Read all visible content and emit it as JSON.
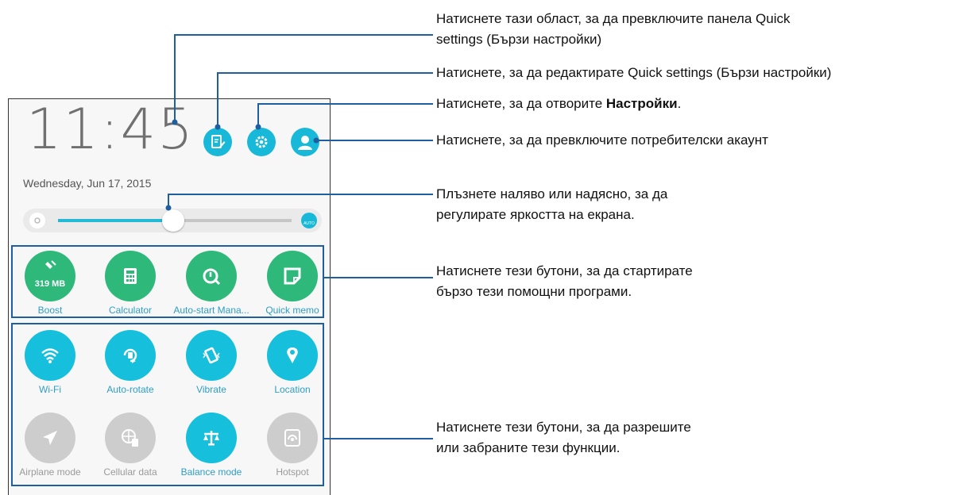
{
  "panel": {
    "clock": "11:45",
    "date": "Wednesday, Jun 17, 2015",
    "brightness_level_percent": 45,
    "brightness_auto_label": "AUTO"
  },
  "utilities": [
    {
      "label": "Boost",
      "badge": "319 MB",
      "icon": "broom-icon"
    },
    {
      "label": "Calculator",
      "icon": "calculator-icon"
    },
    {
      "label": "Auto-start Mana...",
      "icon": "auto-start-icon"
    },
    {
      "label": "Quick memo",
      "icon": "memo-icon"
    }
  ],
  "toggles": [
    {
      "label": "Wi-Fi",
      "icon": "wifi-icon",
      "enabled": true
    },
    {
      "label": "Auto-rotate",
      "icon": "rotate-icon",
      "enabled": true
    },
    {
      "label": "Vibrate",
      "icon": "vibrate-icon",
      "enabled": true
    },
    {
      "label": "Location",
      "icon": "location-icon",
      "enabled": true
    },
    {
      "label": "Airplane mode",
      "icon": "airplane-icon",
      "enabled": false
    },
    {
      "label": "Cellular data",
      "icon": "cellular-data-icon",
      "enabled": false
    },
    {
      "label": "Balance mode",
      "icon": "balance-icon",
      "enabled": true
    },
    {
      "label": "Hotspot",
      "icon": "hotspot-icon",
      "enabled": false
    }
  ],
  "callouts": {
    "toggle_panel_1": "Натиснете тази област, за да превключите панела Quick",
    "toggle_panel_2": "settings (Бързи настройки)",
    "edit_quick_settings": "Натиснете, за да редактирате Quick settings (Бързи настройки)",
    "open_settings_prefix": "Натиснете, за да отворите ",
    "open_settings_bold": "Настройки",
    "open_settings_suffix": ".",
    "switch_account": "Натиснете, за да превключите потребителски акаунт",
    "brightness_1": "Плъзнете наляво или надясно, за да",
    "brightness_2": "регулирате яркостта на екрана.",
    "utilities_1": "Натиснете тези бутони, за да стартирате",
    "utilities_2": "бързо тези помощни програми.",
    "toggles_1": "Натиснете тези бутони, за да разрешите",
    "toggles_2": "или забраните тези функции."
  },
  "colors": {
    "accent": "#18b9d8",
    "utility_green": "#2eb87a",
    "callout_line": "#1f5ea0",
    "disabled": "#cdcdcd"
  }
}
